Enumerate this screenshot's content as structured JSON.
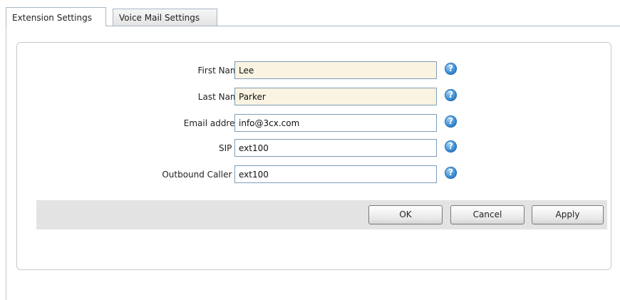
{
  "tabs": [
    {
      "label": "Extension Settings",
      "active": true
    },
    {
      "label": "Voice Mail Settings",
      "active": false
    }
  ],
  "form": {
    "fields": [
      {
        "label": "First Name",
        "value": "Lee"
      },
      {
        "label": "Last Name",
        "value": "Parker"
      },
      {
        "label": "Email address",
        "value": "info@3cx.com"
      },
      {
        "label": "SIP ID",
        "value": "ext100"
      },
      {
        "label": "Outbound Caller ID",
        "value": "ext100"
      }
    ],
    "help_glyph": "?"
  },
  "buttons": {
    "ok": "OK",
    "cancel": "Cancel",
    "apply": "Apply"
  },
  "colors": {
    "filled_input_bg": "#faf3e2",
    "help_icon": "#3d8fd6"
  }
}
